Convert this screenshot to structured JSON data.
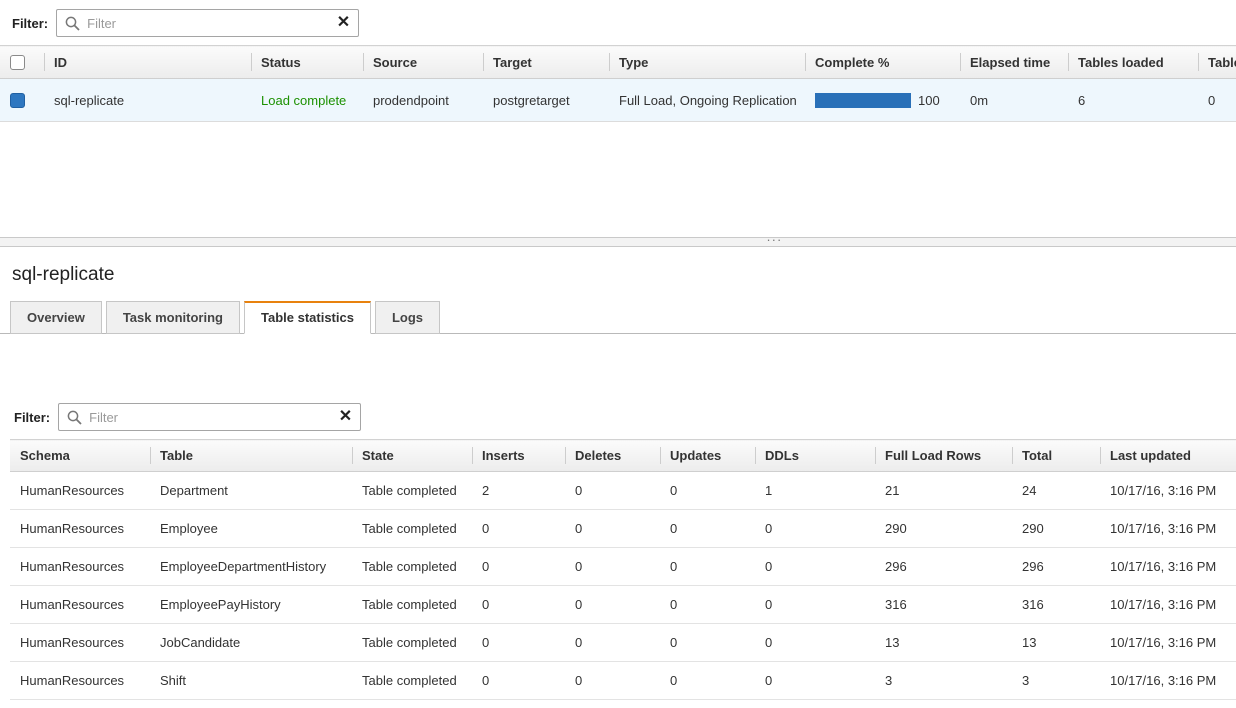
{
  "colors": {
    "accent_orange": "#e8820e",
    "status_green": "#1d9102",
    "progress_blue": "#2970b8",
    "selected_row_bg": "#eef7fd"
  },
  "icons": {
    "clear": "✕",
    "splitter_handle": "···"
  },
  "tasks_panel": {
    "filter_label": "Filter:",
    "filter_placeholder": "Filter",
    "filter_value": "",
    "columns": [
      "ID",
      "Status",
      "Source",
      "Target",
      "Type",
      "Complete %",
      "Elapsed time",
      "Tables loaded",
      "Tables errored"
    ],
    "row": {
      "id": "sql-replicate",
      "status": "Load complete",
      "source": "prodendpoint",
      "target": "postgretarget",
      "type": "Full Load, Ongoing Replication",
      "complete_pct": "100",
      "elapsed_time": "0m",
      "tables_loaded": "6",
      "tables_errored": "0",
      "selected": true
    }
  },
  "detail": {
    "title": "sql-replicate",
    "tabs": [
      {
        "label": "Overview",
        "active": false
      },
      {
        "label": "Task monitoring",
        "active": false
      },
      {
        "label": "Table statistics",
        "active": true
      },
      {
        "label": "Logs",
        "active": false
      }
    ]
  },
  "stats_panel": {
    "filter_label": "Filter:",
    "filter_placeholder": "Filter",
    "filter_value": "",
    "columns": [
      "Schema",
      "Table",
      "State",
      "Inserts",
      "Deletes",
      "Updates",
      "DDLs",
      "Full Load Rows",
      "Total",
      "Last updated"
    ],
    "rows": [
      [
        "HumanResources",
        "Department",
        "Table completed",
        "2",
        "0",
        "0",
        "1",
        "21",
        "24",
        "10/17/16, 3:16 PM"
      ],
      [
        "HumanResources",
        "Employee",
        "Table completed",
        "0",
        "0",
        "0",
        "0",
        "290",
        "290",
        "10/17/16, 3:16 PM"
      ],
      [
        "HumanResources",
        "EmployeeDepartmentHistory",
        "Table completed",
        "0",
        "0",
        "0",
        "0",
        "296",
        "296",
        "10/17/16, 3:16 PM"
      ],
      [
        "HumanResources",
        "EmployeePayHistory",
        "Table completed",
        "0",
        "0",
        "0",
        "0",
        "316",
        "316",
        "10/17/16, 3:16 PM"
      ],
      [
        "HumanResources",
        "JobCandidate",
        "Table completed",
        "0",
        "0",
        "0",
        "0",
        "13",
        "13",
        "10/17/16, 3:16 PM"
      ],
      [
        "HumanResources",
        "Shift",
        "Table completed",
        "0",
        "0",
        "0",
        "0",
        "3",
        "3",
        "10/17/16, 3:16 PM"
      ]
    ]
  }
}
